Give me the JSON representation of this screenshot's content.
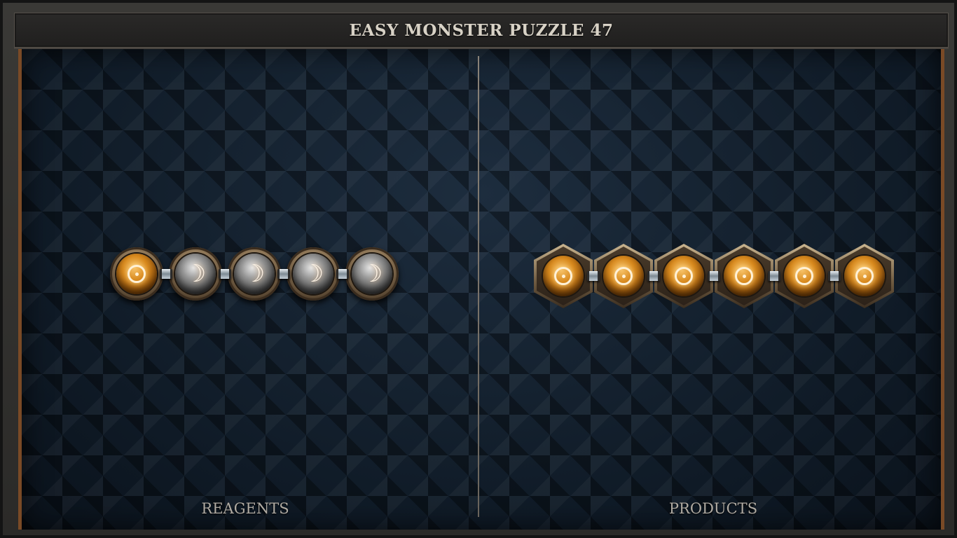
{
  "title": "EASY MONSTER PUZZLE 47",
  "reagents": {
    "label": "REAGENTS",
    "atoms": [
      {
        "symbol": "sun",
        "icon": "sun-orb-icon"
      },
      {
        "symbol": "moon",
        "icon": "moon-orb-icon"
      },
      {
        "symbol": "moon",
        "icon": "moon-orb-icon"
      },
      {
        "symbol": "moon",
        "icon": "moon-orb-icon"
      },
      {
        "symbol": "moon",
        "icon": "moon-orb-icon"
      }
    ]
  },
  "products": {
    "label": "PRODUCTS",
    "atoms": [
      {
        "symbol": "sun",
        "icon": "sun-orb-icon"
      },
      {
        "symbol": "sun",
        "icon": "sun-orb-icon"
      },
      {
        "symbol": "sun",
        "icon": "sun-orb-icon"
      },
      {
        "symbol": "sun",
        "icon": "sun-orb-icon"
      },
      {
        "symbol": "sun",
        "icon": "sun-orb-icon"
      },
      {
        "symbol": "sun",
        "icon": "sun-orb-icon"
      }
    ]
  },
  "colors": {
    "sun_orb": "#d98a1e",
    "moon_orb": "#9a9a9a",
    "board_accent": "#7a4a26"
  }
}
